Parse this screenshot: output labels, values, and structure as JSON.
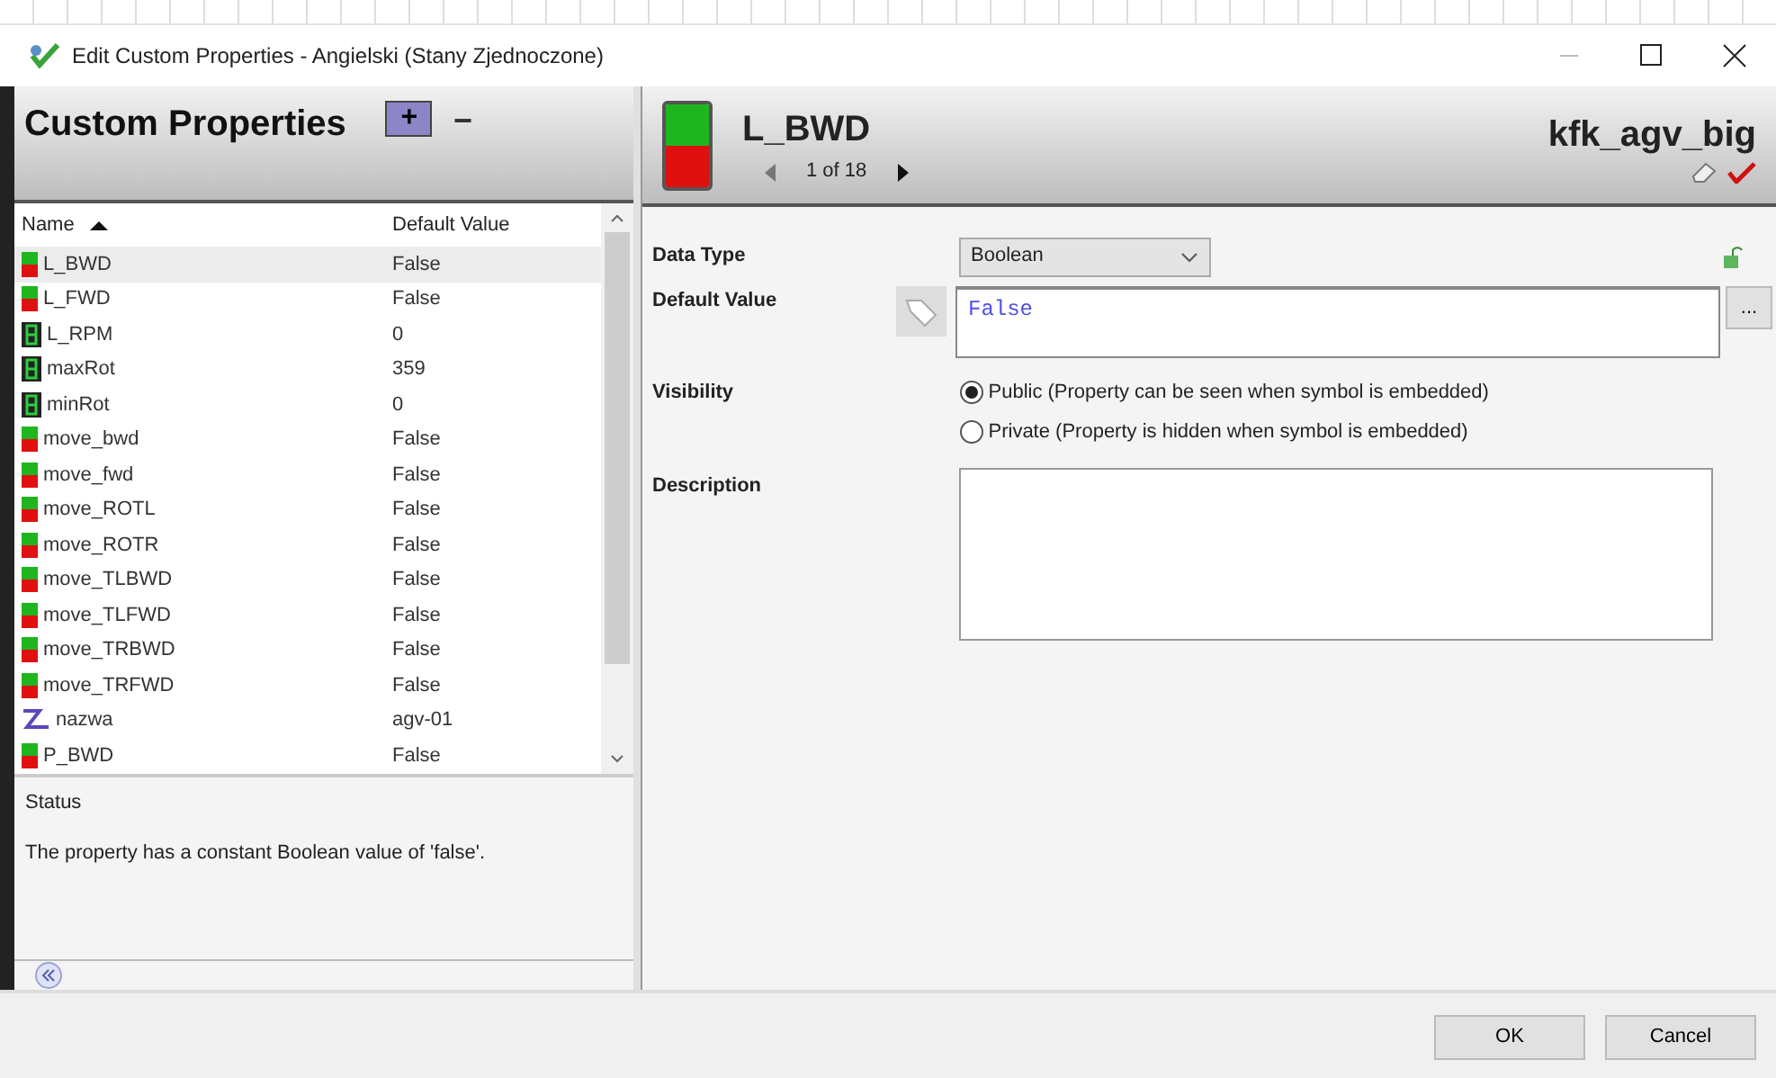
{
  "window": {
    "title": "Edit Custom Properties - Angielski (Stany Zjednoczone)"
  },
  "left_panel": {
    "title": "Custom Properties",
    "add_label": "+",
    "remove_label": "−",
    "columns": [
      {
        "label": "Name"
      },
      {
        "label": "Default Value"
      }
    ],
    "rows": [
      {
        "kind": "switch",
        "name": "L_BWD",
        "value": "False",
        "selected": true
      },
      {
        "kind": "switch",
        "name": "L_FWD",
        "value": "False",
        "selected": false
      },
      {
        "kind": "number",
        "name": "L_RPM",
        "value": "0",
        "selected": false
      },
      {
        "kind": "number",
        "name": "maxRot",
        "value": "359",
        "selected": false
      },
      {
        "kind": "number",
        "name": "minRot",
        "value": "0",
        "selected": false
      },
      {
        "kind": "switch",
        "name": "move_bwd",
        "value": "False",
        "selected": false
      },
      {
        "kind": "switch",
        "name": "move_fwd",
        "value": "False",
        "selected": false
      },
      {
        "kind": "switch",
        "name": "move_ROTL",
        "value": "False",
        "selected": false
      },
      {
        "kind": "switch",
        "name": "move_ROTR",
        "value": "False",
        "selected": false
      },
      {
        "kind": "switch",
        "name": "move_TLBWD",
        "value": "False",
        "selected": false
      },
      {
        "kind": "switch",
        "name": "move_TLFWD",
        "value": "False",
        "selected": false
      },
      {
        "kind": "switch",
        "name": "move_TRBWD",
        "value": "False",
        "selected": false
      },
      {
        "kind": "switch",
        "name": "move_TRFWD",
        "value": "False",
        "selected": false
      },
      {
        "kind": "text",
        "name": "nazwa",
        "value": "agv-01",
        "selected": false
      },
      {
        "kind": "switch",
        "name": "P_BWD",
        "value": "False",
        "selected": false
      }
    ],
    "status": {
      "title": "Status",
      "text": "The property has a constant Boolean value of 'false'."
    }
  },
  "right_panel": {
    "property_name": "L_BWD",
    "navigator": "1 of 18",
    "symbol_name": "kfk_agv_big",
    "data_type": {
      "label": "Data Type",
      "value": "Boolean"
    },
    "default_value": {
      "label": "Default Value",
      "value": "False",
      "browse_label": "..."
    },
    "visibility": {
      "label": "Visibility",
      "options": [
        {
          "label": "Public (Property can be seen when symbol is embedded)",
          "selected": true
        },
        {
          "label": "Private (Property is hidden when symbol is embedded)",
          "selected": false
        }
      ]
    },
    "description": {
      "label": "Description"
    }
  },
  "buttons": [
    {
      "label": "OK"
    },
    {
      "label": "Cancel"
    }
  ]
}
